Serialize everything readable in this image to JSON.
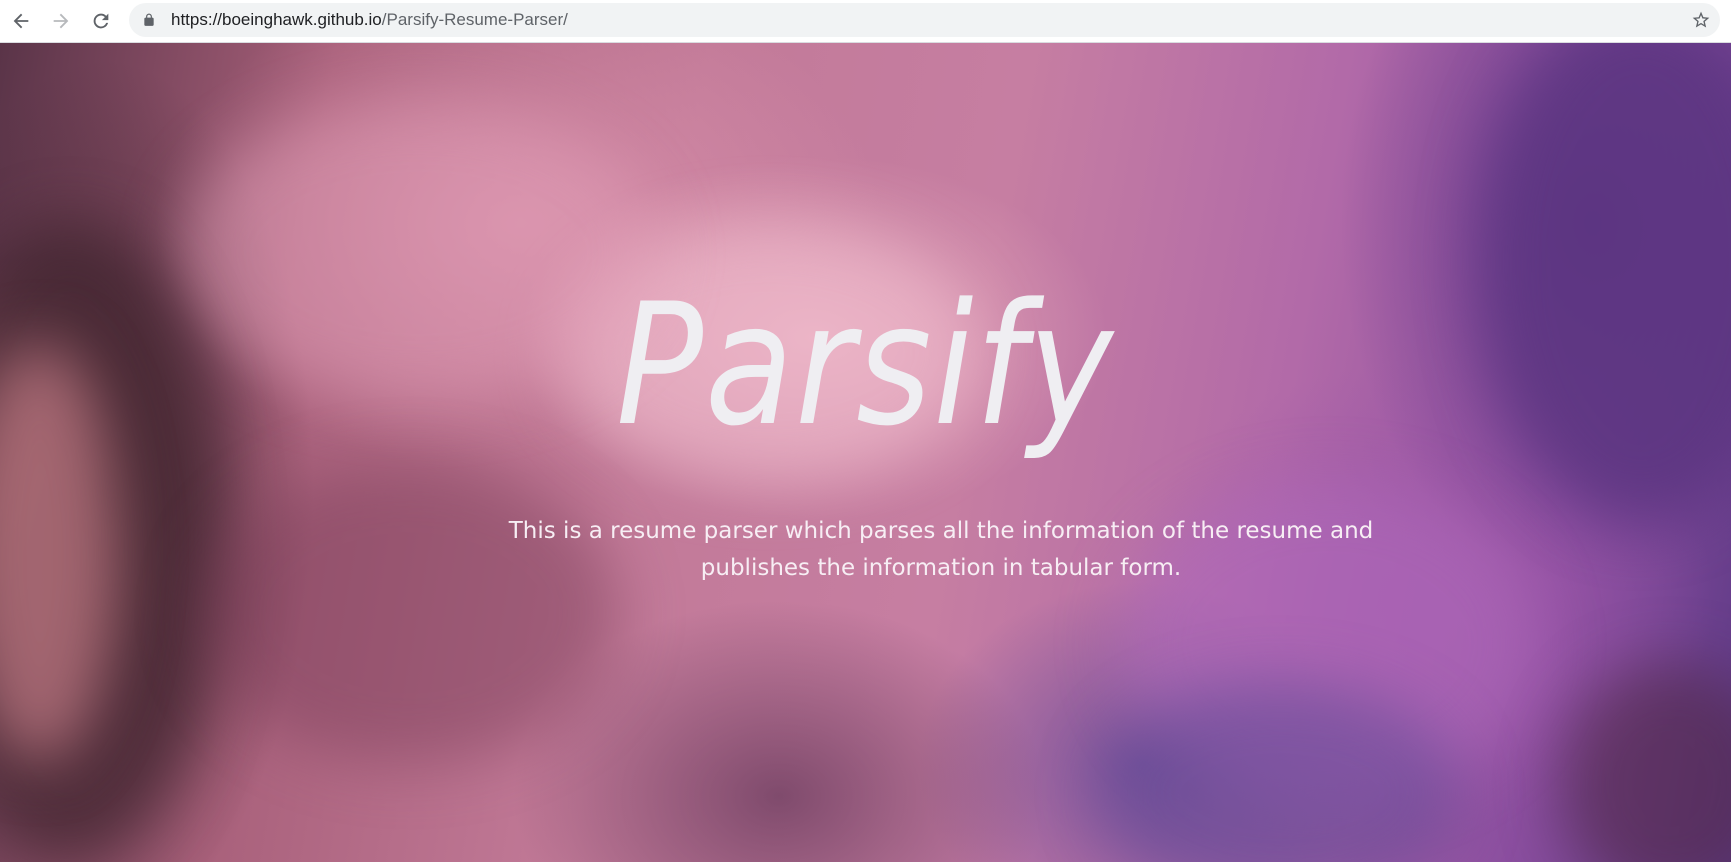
{
  "browser": {
    "url_host": "https://boeinghawk.github.io",
    "url_path": "/Parsify-Resume-Parser/",
    "icons": {
      "back": "back-arrow-icon",
      "forward": "forward-arrow-icon",
      "reload": "reload-icon",
      "lock": "lock-icon",
      "bookmark": "star-icon"
    }
  },
  "hero": {
    "title": "Parsify",
    "subtitle": "This is a resume parser which parses all the information of the resume and publishes the information in tabular form.",
    "colors": {
      "title": "#efeef2",
      "subtitle": "#f7eef4",
      "sky_pink": "#c67ea2",
      "sky_purple": "#6a3f8e",
      "sky_dark": "#4a2c38"
    }
  }
}
